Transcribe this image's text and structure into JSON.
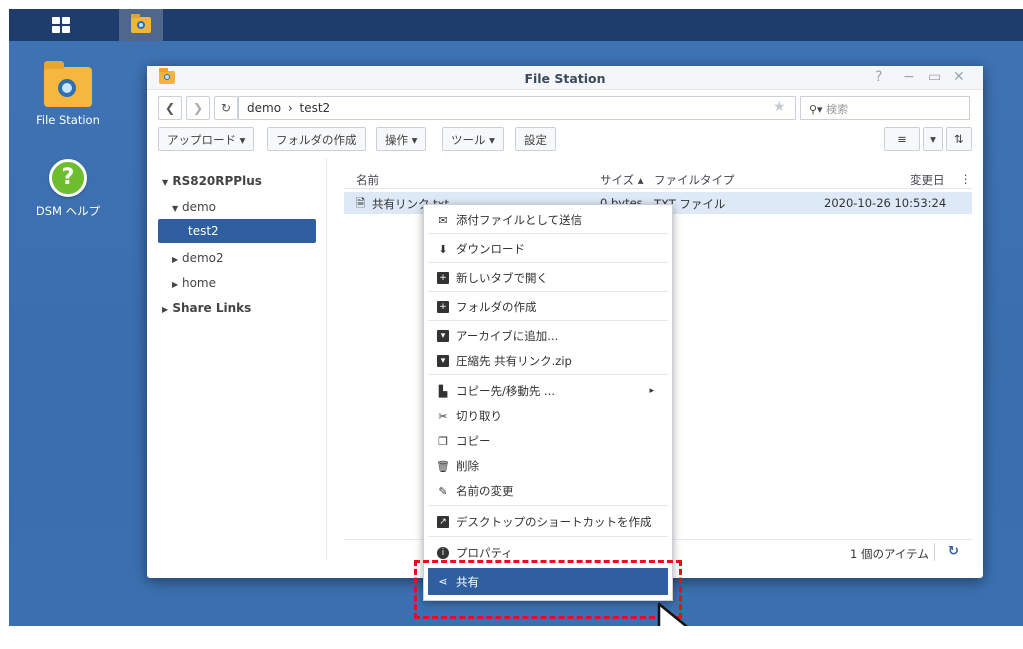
{
  "taskbar": {
    "menu_icon": "main-menu-icon",
    "filestation_icon": "file-station-icon"
  },
  "desktop": {
    "icons": [
      {
        "label": "File Station",
        "icon": "file-station-icon"
      },
      {
        "label": "DSM ヘルプ",
        "icon": "help-icon"
      }
    ]
  },
  "window": {
    "title": "File Station",
    "controls": {
      "help": "?",
      "minimize": "−",
      "maximize": "▭",
      "close": "✕"
    },
    "path": {
      "root": "demo",
      "sep": "›",
      "current": "test2"
    },
    "search_placeholder": "検索",
    "toolbar": {
      "upload": "アップロード ▾",
      "create_folder": "フォルダの作成",
      "action": "操作 ▾",
      "tools": "ツール ▾",
      "settings": "設定"
    },
    "sidebar": {
      "root": "RS820RPPlus",
      "items": [
        "demo",
        "test2",
        "demo2",
        "home"
      ],
      "share_links": "Share Links"
    },
    "columns": {
      "name": "名前",
      "size": "サイズ ▴",
      "type": "ファイルタイプ",
      "modified": "変更日"
    },
    "files": [
      {
        "name": "共有リンク.txt",
        "size": "0 bytes",
        "type": "TXT ファイル",
        "modified": "2020-10-26 10:53:24"
      }
    ],
    "footer": {
      "count": "1 個のアイテム"
    }
  },
  "context_menu": {
    "items": [
      {
        "label": "添付ファイルとして送信",
        "icon": "mail-icon"
      },
      {
        "label": "ダウンロード",
        "icon": "download-icon"
      },
      {
        "label": "新しいタブで開く",
        "icon": "new-tab-icon"
      },
      {
        "label": "フォルダの作成",
        "icon": "add-folder-icon"
      },
      {
        "label": "アーカイブに追加...",
        "icon": "archive-icon"
      },
      {
        "label": "圧縮先 共有リンク.zip",
        "icon": "compress-icon"
      },
      {
        "label": "コピー先/移動先 ...",
        "icon": "copy-move-icon"
      },
      {
        "label": "切り取り",
        "icon": "cut-icon"
      },
      {
        "label": "コピー",
        "icon": "copy-icon"
      },
      {
        "label": "削除",
        "icon": "delete-icon"
      },
      {
        "label": "名前の変更",
        "icon": "rename-icon"
      },
      {
        "label": "デスクトップのショートカットを作成",
        "icon": "shortcut-icon"
      },
      {
        "label": "プロパティ",
        "icon": "info-icon"
      },
      {
        "label": "共有",
        "icon": "share-icon"
      }
    ],
    "submenu_arrow": "▸",
    "highlighted": "共有"
  },
  "colors": {
    "desktop": "#3a6ead",
    "selection": "#2f5fa0",
    "annotation": "#e4101f"
  }
}
